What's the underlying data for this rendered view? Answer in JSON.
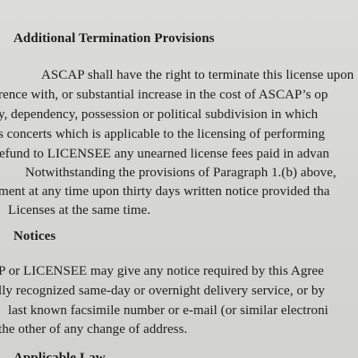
{
  "sections": [
    {
      "heading": "Additional Termination Provisions",
      "lines": [
        "ASCAP shall have the right to terminate this license upon",
        "rence with, or substantial increase in the cost of ASCAP’s op",
        "y, dependency, possession or political subdivision in which",
        "s concerts which is applicable to the licensing of performing",
        "efund to LICENSEE any unearned license fees paid in advan",
        "Notwithstanding the provisions of Paragraph 1.(b) above,",
        "ment at any time upon thirty days written notice provided tha",
        "Licenses at the same time."
      ]
    },
    {
      "heading": "Notices",
      "lines": [
        "P or LICENSEE may give any notice required by this Agree",
        "lly recognized same-day or overnight delivery service, or by",
        "last known facsimile number or e-mail (or similar electroni",
        "the other of any change of address."
      ]
    },
    {
      "heading": "Applicable Law"
    }
  ]
}
